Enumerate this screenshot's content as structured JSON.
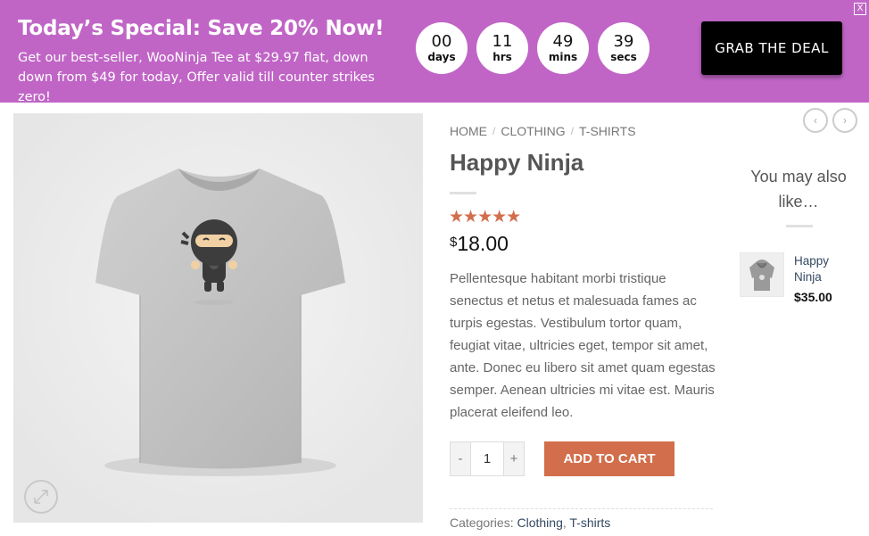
{
  "banner": {
    "title": "Today’s Special: Save 20% Now!",
    "line1": "Get our best-seller, WooNinja Tee at $29.97 flat, down",
    "line2": "down from $49 for today, Offer valid till counter strikes zero!",
    "countdown": [
      {
        "value": "00",
        "label": "days"
      },
      {
        "value": "11",
        "label": "hrs"
      },
      {
        "value": "49",
        "label": "mins"
      },
      {
        "value": "39",
        "label": "secs"
      }
    ],
    "cta_label": "GRAB THE DEAL",
    "close_label": "X",
    "color": "#c065c6"
  },
  "breadcrumb": {
    "items": [
      "HOME",
      "CLOTHING",
      "T-SHIRTS"
    ],
    "separator": "/"
  },
  "product": {
    "title": "Happy Ninja",
    "rating_stars": "★★★★★",
    "rating": 5,
    "currency": "$",
    "price": "18.00",
    "description": "Pellentesque habitant morbi tristique senectus et netus et malesuada fames ac turpis egestas. Vestibulum tortor quam, feugiat vitae, ultricies eget, tempor sit amet, ante. Donec eu libero sit amet quam egestas semper. Aenean ultricies mi vitae est. Mauris placerat eleifend leo.",
    "quantity": "1",
    "minus_label": "-",
    "plus_label": "+",
    "add_to_cart_label": "ADD TO CART",
    "categories_label": "Categories:",
    "categories": [
      "Clothing",
      "T-shirts"
    ],
    "accent_color": "#d26e4b"
  },
  "related": {
    "heading_line1": "You may also",
    "heading_line2": "like…",
    "items": [
      {
        "name": "Happy Ninja",
        "price": "$35.00"
      }
    ]
  },
  "icons": {
    "zoom": "expand-icon",
    "prev": "chevron-left-icon",
    "next": "chevron-right-icon"
  }
}
